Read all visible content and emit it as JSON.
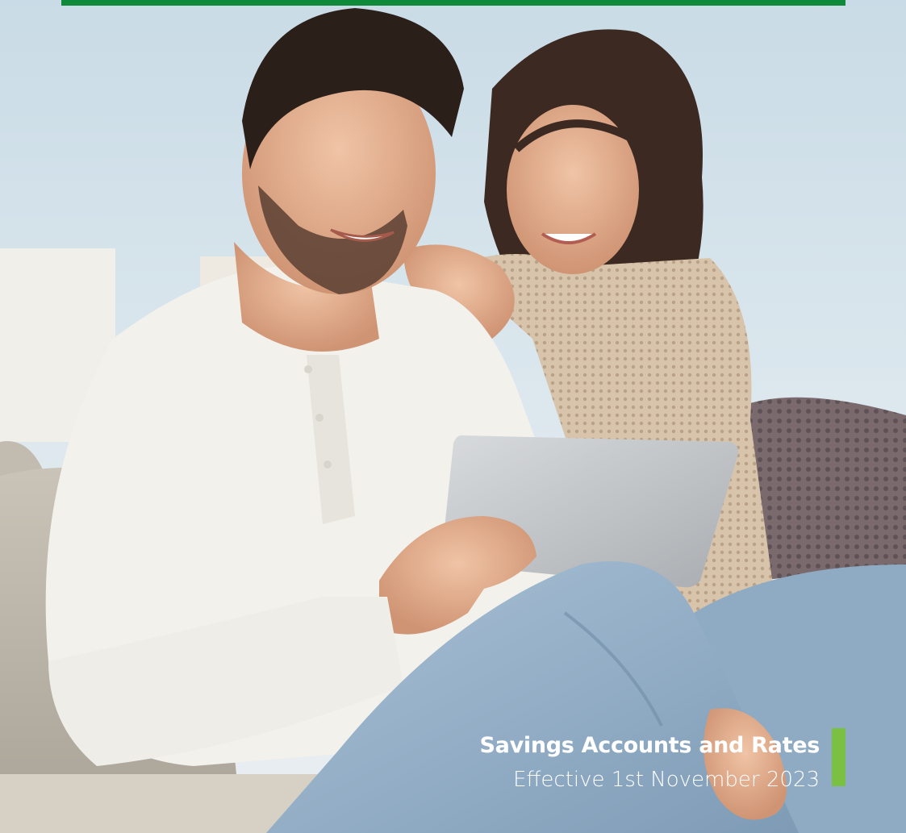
{
  "colors": {
    "brand_green": "#0f8a3a",
    "accent_green": "#79c043",
    "text": "#ffffff"
  },
  "cover": {
    "image": "photo-couple-with-tablet",
    "title": "Savings Accounts and Rates",
    "subtitle": "Effective 1st November 2023"
  }
}
